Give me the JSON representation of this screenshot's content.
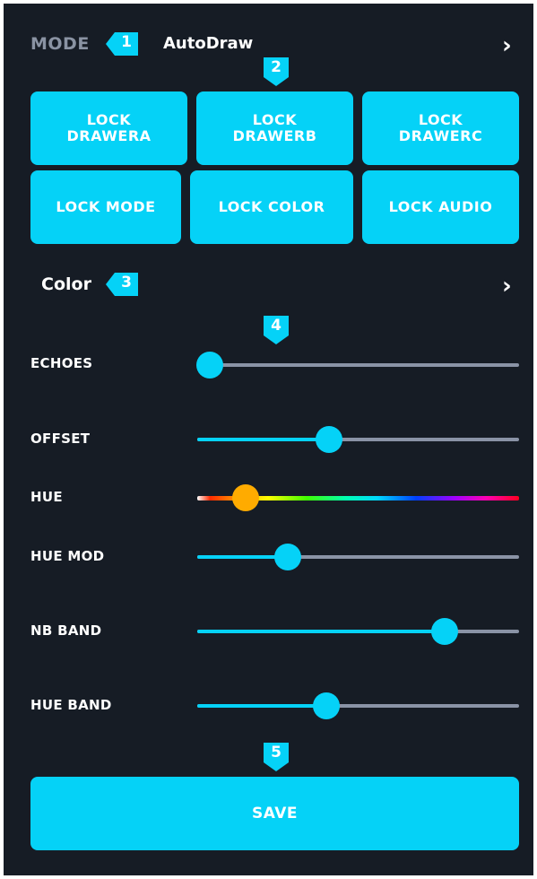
{
  "colors": {
    "accent": "#05d2f7",
    "background": "#161c25",
    "hue_thumb": "#ffab00",
    "track": "#8a93a6"
  },
  "mode": {
    "label": "MODE",
    "value": "AutoDraw",
    "chevron_icon": "chevron-right-icon"
  },
  "markers": [
    "1",
    "2",
    "3",
    "4",
    "5"
  ],
  "lock_buttons": [
    "LOCK\nDRAWERA",
    "LOCK\nDRAWERB",
    "LOCK\nDRAWERC",
    "LOCK MODE",
    "LOCK COLOR",
    "LOCK AUDIO"
  ],
  "color_section": {
    "label": "Color",
    "chevron_icon": "chevron-right-icon"
  },
  "sliders": [
    {
      "label": "ECHOES",
      "value": 0.04
    },
    {
      "label": "OFFSET",
      "value": 0.41
    },
    {
      "label": "HUE",
      "value": 0.15
    },
    {
      "label": "HUE MOD",
      "value": 0.28
    },
    {
      "label": "NB BAND",
      "value": 0.77
    },
    {
      "label": "HUE BAND",
      "value": 0.4
    }
  ],
  "save_label": "SAVE"
}
